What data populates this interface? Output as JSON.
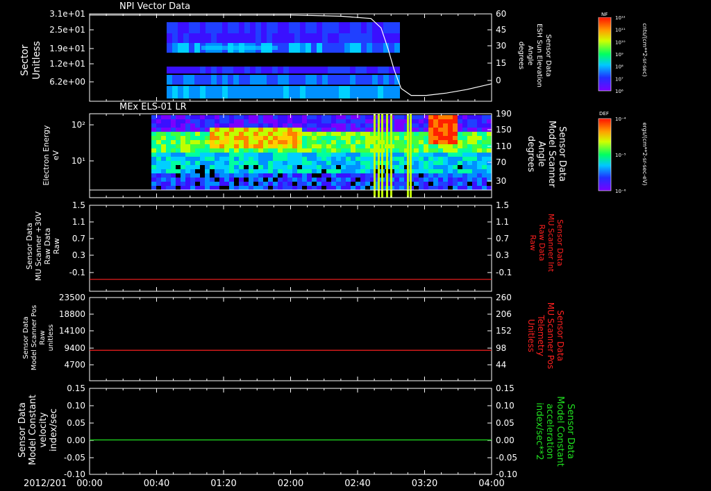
{
  "date_label": "2012/201",
  "time_ticks": [
    "00:00",
    "00:40",
    "01:20",
    "02:00",
    "02:40",
    "03:20",
    "04:00"
  ],
  "colors": {
    "background": "#000000",
    "axis": "#ffffff",
    "trace_red": "#ff2020",
    "trace_green": "#20e020",
    "label_red": "#ff2020",
    "label_green": "#20e020"
  },
  "chart_data": [
    {
      "id": "npi",
      "type": "heatmap",
      "title": "NPI Vector Data",
      "ylabel": [
        "Sector",
        "Unitless"
      ],
      "yticks": [
        "3.1e+01",
        "2.5e+01",
        "1.9e+01",
        "1.2e+01",
        "6.2e+00"
      ],
      "right_label": [
        "Sensor Data",
        "ESH Sun Elevation",
        "Angle",
        "degrees"
      ],
      "right_ticks": [
        "60",
        "45",
        "30",
        "15",
        "0"
      ],
      "line_series": {
        "name": "ESH Sun Elevation",
        "x_hours": [
          0.0,
          0.5,
          1.0,
          1.5,
          2.0,
          2.5,
          2.8,
          2.9,
          2.97,
          3.03,
          3.1,
          3.2,
          3.35,
          3.55,
          3.75,
          4.0
        ],
        "y": [
          59,
          59,
          59,
          59,
          59,
          58,
          56,
          48,
          30,
          12,
          -4,
          -10,
          -10,
          -8,
          -5,
          0
        ],
        "ylim": [
          -15,
          60
        ]
      },
      "colorbar": {
        "title": "NF",
        "label": "cnts/(cm**2-sr-sec)",
        "ticks": [
          "10¹²",
          "10¹¹",
          "10¹⁰",
          "10⁹",
          "10⁸",
          "10⁷",
          "10⁶"
        ]
      }
    },
    {
      "id": "els",
      "type": "heatmap",
      "title": "MEx ELS-01 LR",
      "ylabel": [
        "Electron Energy",
        "eV"
      ],
      "yticks": [
        "10²",
        "10¹"
      ],
      "right_label": [
        "Sensor Data",
        "Model Scanner",
        "Angle",
        "degrees"
      ],
      "right_ticks": [
        "190",
        "150",
        "110",
        "70",
        "30"
      ],
      "colorbar": {
        "title": "DEF",
        "label": "ergs/(cm**2-sr-sec-eV)",
        "ticks": [
          "10⁻⁴",
          "10⁻⁵",
          "10⁻⁶"
        ]
      }
    },
    {
      "id": "mu-raw",
      "type": "line",
      "ylabel": [
        "Sensor Data",
        "MU Scanner +30V",
        "Raw Data",
        "Raw"
      ],
      "yticks": [
        "1.5",
        "1.1",
        "0.7",
        "0.3",
        "-0.1"
      ],
      "ylim": [
        -0.3,
        1.5
      ],
      "right_label": [
        "Sensor Data",
        "MU Scanner Int",
        "Raw Data",
        "Raw"
      ],
      "right_ticks": [
        "1.5",
        "1.1",
        "0.7",
        "0.3",
        "-0.1"
      ],
      "series": [
        {
          "x_hours": [
            0,
            4
          ],
          "values": [
            -0.05,
            -0.05
          ]
        }
      ]
    },
    {
      "id": "scanner-pos",
      "type": "line",
      "ylabel": [
        "Sensor Data",
        "Model Scanner Pos",
        "Raw",
        "unitless"
      ],
      "yticks": [
        "23500",
        "18800",
        "14100",
        "9400",
        "4700"
      ],
      "ylim": [
        0,
        23500
      ],
      "right_label": [
        "Sensor Data",
        "MU Scanner Pos",
        "Telemetry",
        "Unitless"
      ],
      "right_ticks": [
        "260",
        "206",
        "152",
        "98",
        "44"
      ],
      "series": [
        {
          "x_hours": [
            0,
            4
          ],
          "values": [
            8600,
            8600
          ]
        }
      ]
    },
    {
      "id": "model-constant",
      "type": "line",
      "ylabel": [
        "Sensor Data",
        "Model Constant",
        "velocity",
        "index/sec"
      ],
      "yticks": [
        "0.15",
        "0.10",
        "0.05",
        "0.00",
        "-0.05",
        "-0.10"
      ],
      "ylim": [
        -0.1,
        0.15
      ],
      "right_label": [
        "Sensor Data",
        "Model Constant",
        "acceleration",
        "index/sec**2"
      ],
      "right_ticks": [
        "0.15",
        "0.10",
        "0.05",
        "0.00",
        "-0.05",
        "-0.10"
      ],
      "series": [
        {
          "x_hours": [
            0,
            4
          ],
          "values": [
            0.0,
            0.0
          ]
        }
      ]
    }
  ]
}
